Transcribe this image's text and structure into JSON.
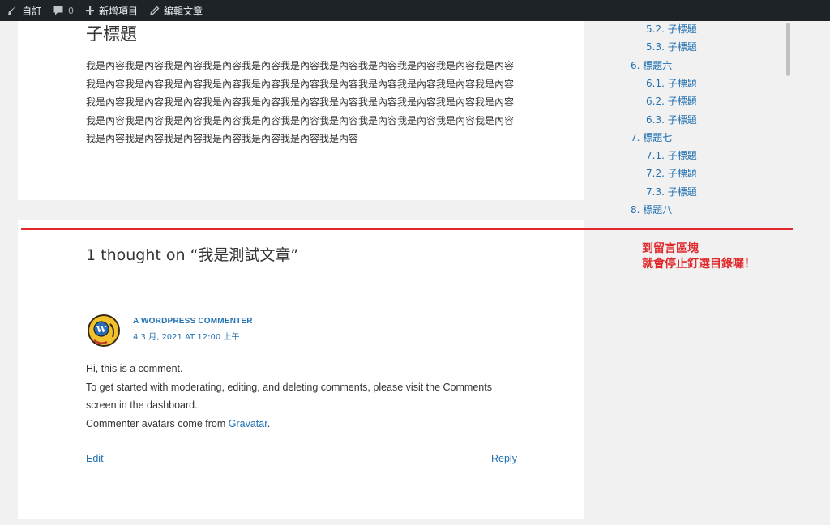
{
  "admin_bar": {
    "customize_label": "自訂",
    "comments_count": "0",
    "new_item_label": "新增項目",
    "edit_post_label": "編輯文章"
  },
  "article": {
    "subheading": "子標題",
    "paragraph": "我是內容我是內容我是內容我是內容我是內容我是內容我是內容我是內容我是內容我是內容我是內容我是內容我是內容我是內容我是內容我是內容我是內容我是內容我是內容我是內容我是內容我是內容我是內容我是內容我是內容我是內容我是內容我是內容我是內容我是內容我是內容我是內容我是內容我是內容我是內容我是內容我是內容我是內容我是內容我是內容我是內容我是內容我是內容我是內容我是內容我是內容我是內容我是內容我是內容我是內容我是內容"
  },
  "toc": {
    "items": [
      {
        "label": "5.2. 子標題",
        "level": 2
      },
      {
        "label": "5.3. 子標題",
        "level": 2
      },
      {
        "label": "6. 標題六",
        "level": 1
      },
      {
        "label": "6.1. 子標題",
        "level": 2
      },
      {
        "label": "6.2. 子標題",
        "level": 2
      },
      {
        "label": "6.3. 子標題",
        "level": 2
      },
      {
        "label": "7. 標題七",
        "level": 1
      },
      {
        "label": "7.1. 子標題",
        "level": 2
      },
      {
        "label": "7.2. 子標題",
        "level": 2
      },
      {
        "label": "7.3. 子標題",
        "level": 2
      },
      {
        "label": "8. 標題八",
        "level": 1
      }
    ]
  },
  "annotation": {
    "line1": "到留言區塊",
    "line2": "就會停止釘選目錄囉！",
    "color": "#e0282b"
  },
  "comments": {
    "title": "1 thought on “我是測試文章”",
    "author": "A WORDPRESS COMMENTER",
    "date": "4 3 月, 2021 AT 12:00 上午",
    "line1": "Hi, this is a comment.",
    "line2": "To get started with moderating, editing, and deleting comments, please visit the Comments",
    "line3": "screen in the dashboard.",
    "line4_prefix": "Commenter avatars come from ",
    "gravatar_link": "Gravatar",
    "line4_suffix": ".",
    "edit_label": "Edit",
    "reply_label": "Reply"
  },
  "colors": {
    "link": "#2271b1",
    "admin_bar_bg": "#1d2327",
    "accent_red": "#e0282b"
  }
}
